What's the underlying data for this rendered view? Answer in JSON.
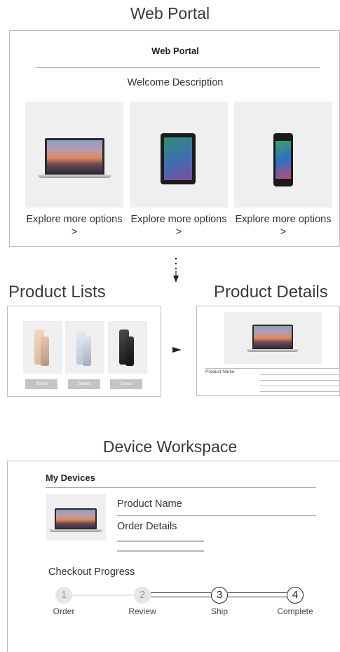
{
  "portal": {
    "title": "Web Portal",
    "card_title": "Web Portal",
    "welcome": "Welcome Description",
    "items": [
      {
        "label": "Explore more options >",
        "device": "laptop-icon"
      },
      {
        "label": "Explore more options >",
        "device": "tablet-icon"
      },
      {
        "label": "Explore more options >",
        "device": "phone-icon"
      }
    ]
  },
  "flow": {
    "arrow_down": "⋮",
    "list_title": "Product Lists",
    "details_title": "Product Details",
    "select_label": "Select",
    "product_name": "Product Name"
  },
  "workspace": {
    "title": "Device Workspace",
    "my_devices": "My Devices",
    "product_name": "Product Name",
    "order_details": "Order Details",
    "checkout": "Checkout Progress",
    "steps": [
      {
        "num": "1",
        "label": "Order"
      },
      {
        "num": "2",
        "label": "Review"
      },
      {
        "num": "3",
        "label": "Ship"
      },
      {
        "num": "4",
        "label": "Complete"
      }
    ]
  },
  "colors": {
    "border": "#bdbdbd",
    "tile": "#efefef",
    "muted": "#c4c4c4",
    "text": "#333333"
  }
}
